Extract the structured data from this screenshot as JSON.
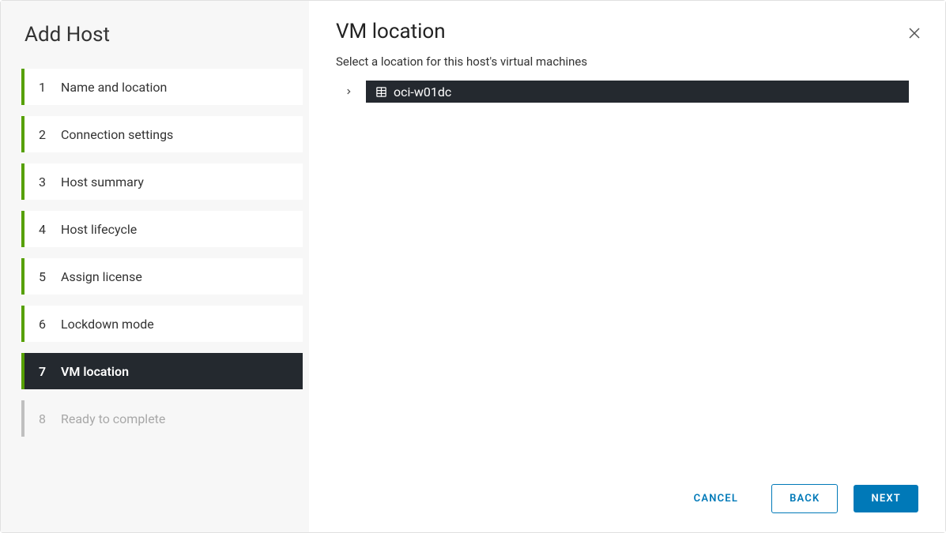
{
  "wizard": {
    "title": "Add Host",
    "steps": [
      {
        "num": "1",
        "label": "Name and location",
        "state": "done"
      },
      {
        "num": "2",
        "label": "Connection settings",
        "state": "done"
      },
      {
        "num": "3",
        "label": "Host summary",
        "state": "done"
      },
      {
        "num": "4",
        "label": "Host lifecycle",
        "state": "done"
      },
      {
        "num": "5",
        "label": "Assign license",
        "state": "done"
      },
      {
        "num": "6",
        "label": "Lockdown mode",
        "state": "done"
      },
      {
        "num": "7",
        "label": "VM location",
        "state": "active"
      },
      {
        "num": "8",
        "label": "Ready to complete",
        "state": "upcoming"
      }
    ]
  },
  "content": {
    "title": "VM location",
    "subtitle": "Select a location for this host's virtual machines",
    "tree": {
      "selected": {
        "label": "oci-w01dc"
      }
    }
  },
  "footer": {
    "cancel": "CANCEL",
    "back": "BACK",
    "next": "NEXT"
  }
}
